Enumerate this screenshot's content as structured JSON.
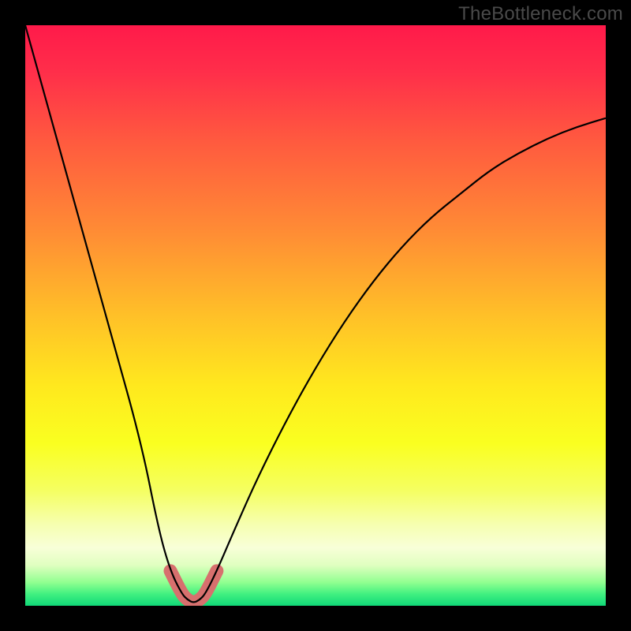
{
  "watermark": "TheBottleneck.com",
  "chart_data": {
    "type": "line",
    "title": "",
    "xlabel": "",
    "ylabel": "",
    "xlim": [
      0,
      100
    ],
    "ylim": [
      0,
      100
    ],
    "grid": false,
    "legend": false,
    "series": [
      {
        "name": "bottleneck-curve",
        "x": [
          0,
          5,
          10,
          15,
          20,
          23,
          25,
          27,
          28,
          29,
          30,
          31,
          33,
          36,
          40,
          45,
          50,
          55,
          60,
          65,
          70,
          75,
          80,
          85,
          90,
          95,
          100
        ],
        "values": [
          100,
          82,
          64,
          46,
          28,
          13,
          6,
          2,
          1,
          0.5,
          1,
          2,
          6,
          13,
          22,
          32,
          41,
          49,
          56,
          62,
          67,
          71,
          75,
          78,
          80.5,
          82.5,
          84
        ]
      }
    ],
    "highlight_region": {
      "name": "valley-highlight",
      "x_range": [
        24.5,
        33.5
      ],
      "color": "#d7706e"
    },
    "background_gradient": {
      "stops": [
        {
          "offset": 0.0,
          "color": "#ff1a4a"
        },
        {
          "offset": 0.08,
          "color": "#ff2e4a"
        },
        {
          "offset": 0.2,
          "color": "#ff5a3f"
        },
        {
          "offset": 0.35,
          "color": "#ff8a35"
        },
        {
          "offset": 0.5,
          "color": "#ffc028"
        },
        {
          "offset": 0.62,
          "color": "#ffe81e"
        },
        {
          "offset": 0.72,
          "color": "#faff20"
        },
        {
          "offset": 0.8,
          "color": "#f5ff60"
        },
        {
          "offset": 0.86,
          "color": "#f6ffb0"
        },
        {
          "offset": 0.9,
          "color": "#f8ffd8"
        },
        {
          "offset": 0.93,
          "color": "#e0ffc0"
        },
        {
          "offset": 0.96,
          "color": "#90ff90"
        },
        {
          "offset": 0.98,
          "color": "#40f080"
        },
        {
          "offset": 1.0,
          "color": "#10d878"
        }
      ]
    }
  }
}
